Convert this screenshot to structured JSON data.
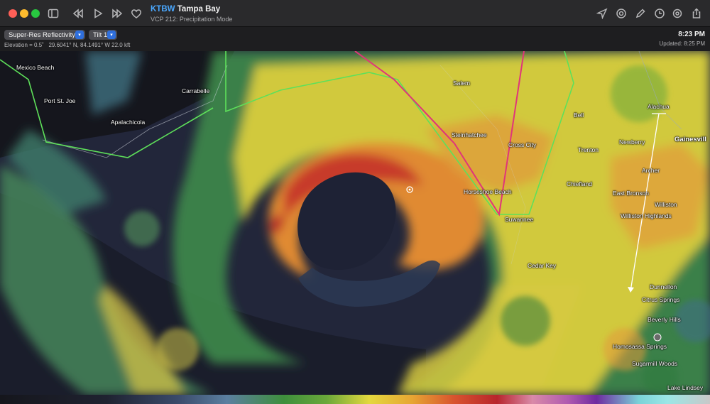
{
  "window": {
    "station_code": "KTBW",
    "station_name": "Tampa Bay",
    "mode": "VCP 212: Precipitation Mode"
  },
  "toolbar_icons": [
    "sidebar-icon",
    "rewind-icon",
    "play-icon",
    "fast-forward-icon",
    "heart-icon",
    "location-icon",
    "target-icon",
    "pencil-icon",
    "clock-icon",
    "gear-icon",
    "share-icon"
  ],
  "controls": {
    "product": "Super-Res Reflectivity",
    "tilt": "Tilt 1",
    "elevation": "Elevation = 0.5˚",
    "coords": "29.6041° N, 84.1491° W 22.0 kft",
    "time": "8:23 PM",
    "updated": "Updated: 8:25 PM"
  },
  "map": {
    "labels": {
      "mexico_beach": "Mexico Beach",
      "port_st_joe": "Port St. Joe",
      "carrabelle": "Carrabelle",
      "apalachicola": "Apalachicola",
      "salem": "Salem",
      "steinhatchee": "Steinhatchee",
      "cross_city": "Cross City",
      "bell": "Bell",
      "alachua": "Alachua",
      "gainesville": "Gainesvill",
      "newberry": "Newberry",
      "trenton": "Trenton",
      "archer": "Archer",
      "chiefland": "Chiefland",
      "horseshoe_beach": "Horseshoe Beach",
      "east_bronson": "East Bronson",
      "williston": "Williston",
      "williston_highlands": "Williston Highlands",
      "suwannee": "Suwannee",
      "cedar_key": "Cedar Key",
      "dunnellon": "Dunnellon",
      "citrus_springs": "Citrus Springs",
      "beverly_hills": "Beverly Hills",
      "homosassa_springs": "Homosassa Springs",
      "sugarmill_woods": "Sugarmill Woods",
      "lake_lindsey": "Lake Lindsey"
    },
    "colors": {
      "light": "#3f8a4a",
      "moderate": "#e2d23d",
      "heavy": "#e08a33",
      "intense": "#c73a2c",
      "warning_box": "#5ee05a",
      "track": "#e0357a"
    }
  }
}
